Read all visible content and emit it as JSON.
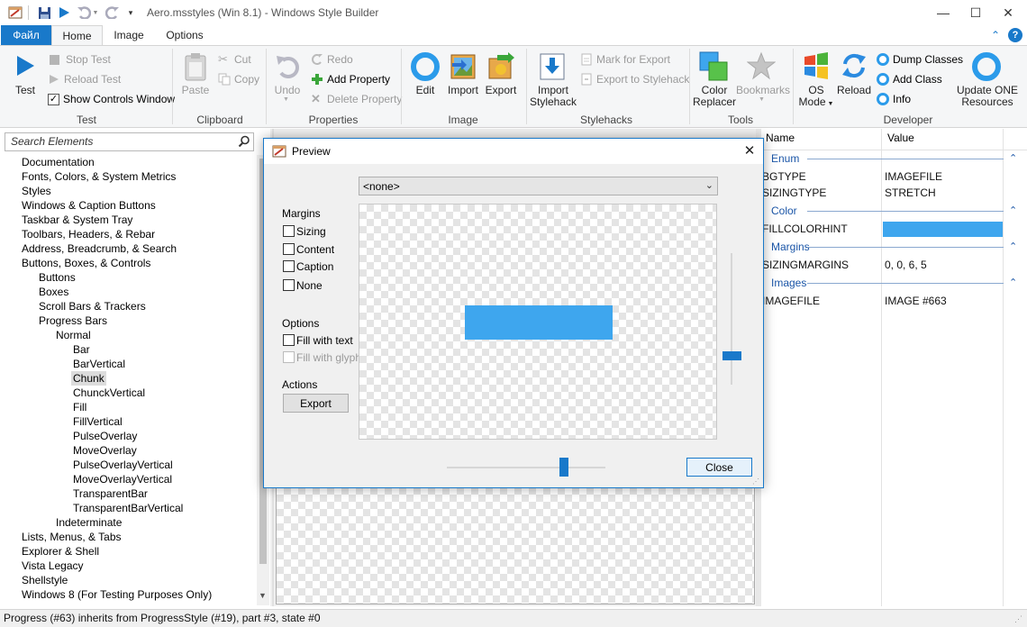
{
  "window": {
    "title": "Aero.msstyles (Win 8.1) - Windows Style Builder",
    "minimize": "—",
    "maximize": "☐",
    "close": "✕"
  },
  "ribbon_tabs": {
    "file": "Файл",
    "home": "Home",
    "image": "Image",
    "options": "Options",
    "collapse": "⌃",
    "help": "?"
  },
  "ribbon": {
    "test": {
      "label": "Test",
      "stop_test": "Stop Test",
      "reload_test": "Reload Test",
      "show_controls_window": "Show Controls Window",
      "group": "Test"
    },
    "clipboard": {
      "paste": "Paste",
      "cut": "Cut",
      "copy": "Copy",
      "group": "Clipboard"
    },
    "properties": {
      "undo": "Undo",
      "redo": "Redo",
      "add_property": "Add Property",
      "delete_property": "Delete Property",
      "group": "Properties"
    },
    "image": {
      "edit": "Edit",
      "import": "Import",
      "export": "Export",
      "group": "Image"
    },
    "stylehacks": {
      "import_stylehack_1": "Import",
      "import_stylehack_2": "Stylehack",
      "mark_for_export": "Mark for Export",
      "export_to_stylehack": "Export to Stylehack",
      "group": "Stylehacks"
    },
    "tools": {
      "color_replacer_1": "Color",
      "color_replacer_2": "Replacer",
      "bookmarks": "Bookmarks",
      "group": "Tools"
    },
    "developer": {
      "os_mode_1": "OS",
      "os_mode_2": "Mode",
      "reload": "Reload",
      "dump_classes": "Dump Classes",
      "add_class": "Add Class",
      "info": "Info",
      "update_one_1": "Update ONE",
      "update_one_2": "Resources",
      "group": "Developer"
    }
  },
  "search": {
    "placeholder": "Search Elements"
  },
  "tree": [
    {
      "label": "Documentation",
      "level": 0
    },
    {
      "label": "Fonts, Colors, & System Metrics",
      "level": 0
    },
    {
      "label": "Styles",
      "level": 0
    },
    {
      "label": "Windows & Caption Buttons",
      "level": 0
    },
    {
      "label": "Taskbar & System Tray",
      "level": 0
    },
    {
      "label": "Toolbars, Headers, & Rebar",
      "level": 0
    },
    {
      "label": "Address, Breadcrumb, & Search",
      "level": 0
    },
    {
      "label": "Buttons, Boxes, & Controls",
      "level": 0
    },
    {
      "label": "Buttons",
      "level": 1
    },
    {
      "label": "Boxes",
      "level": 1
    },
    {
      "label": "Scroll Bars & Trackers",
      "level": 1
    },
    {
      "label": "Progress Bars",
      "level": 1
    },
    {
      "label": "Normal",
      "level": 2
    },
    {
      "label": "Bar",
      "level": 3
    },
    {
      "label": "BarVertical",
      "level": 3
    },
    {
      "label": "Chunk",
      "level": 3,
      "selected": true
    },
    {
      "label": "ChunckVertical",
      "level": 3
    },
    {
      "label": "Fill",
      "level": 3
    },
    {
      "label": "FillVertical",
      "level": 3
    },
    {
      "label": "PulseOverlay",
      "level": 3
    },
    {
      "label": "MoveOverlay",
      "level": 3
    },
    {
      "label": "PulseOverlayVertical",
      "level": 3
    },
    {
      "label": "MoveOverlayVertical",
      "level": 3
    },
    {
      "label": "TransparentBar",
      "level": 3
    },
    {
      "label": "TransparentBarVertical",
      "level": 3
    },
    {
      "label": "Indeterminate",
      "level": 2
    },
    {
      "label": "Lists, Menus, & Tabs",
      "level": 0
    },
    {
      "label": "Explorer & Shell",
      "level": 0
    },
    {
      "label": "Vista Legacy",
      "level": 0
    },
    {
      "label": "Shellstyle",
      "level": 0
    },
    {
      "label": "Windows 8 (For Testing Purposes Only)",
      "level": 0
    }
  ],
  "properties": {
    "col_name": "Name",
    "col_value": "Value",
    "sections": [
      {
        "title": "Enum",
        "rows": [
          {
            "name": "BGTYPE",
            "value": "IMAGEFILE"
          },
          {
            "name": "SIZINGTYPE",
            "value": "STRETCH"
          }
        ]
      },
      {
        "title": "Color",
        "rows": [
          {
            "name": "FILLCOLORHINT",
            "value": "",
            "swatch": "#3ea6ee"
          }
        ]
      },
      {
        "title": "Margins",
        "rows": [
          {
            "name": "SIZINGMARGINS",
            "value": "0, 0, 6, 5"
          }
        ]
      },
      {
        "title": "Images",
        "rows": [
          {
            "name": "IMAGEFILE",
            "value": "IMAGE #663"
          }
        ]
      }
    ]
  },
  "dialog": {
    "title": "Preview",
    "dropdown_value": "<none>",
    "margins_heading": "Margins",
    "sizing": "Sizing",
    "content": "Content",
    "caption": "Caption",
    "none": "None",
    "options_heading": "Options",
    "fill_with_text": "Fill with text",
    "fill_with_glyph": "Fill with glyph",
    "actions_heading": "Actions",
    "export_button": "Export",
    "close_button": "Close",
    "preview_color": "#3ea6ee",
    "horizontal_slider_value": 0.75,
    "vertical_slider_value": 0.8
  },
  "status": {
    "text": "Progress (#63) inherits from ProgressStyle (#19), part #3, state #0"
  },
  "colors": {
    "accent": "#1979ca",
    "fill": "#3ea6ee"
  }
}
